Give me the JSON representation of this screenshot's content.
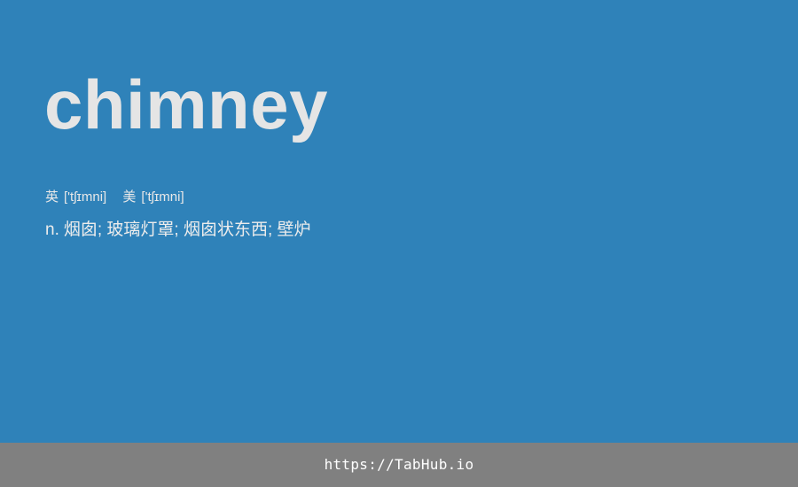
{
  "entry": {
    "word": "chimney",
    "phonetics": [
      {
        "region": "英",
        "ipa": "['tʃɪmni]"
      },
      {
        "region": "美",
        "ipa": "['tʃɪmni]"
      }
    ],
    "definition": {
      "pos": "n.",
      "meanings": "烟囱; 玻璃灯罩; 烟囱状东西; 壁炉"
    }
  },
  "footer": {
    "url": "https://TabHub.io"
  },
  "colors": {
    "background": "#2f82b9",
    "footer_background": "#808080",
    "word_text": "#e5e5e5"
  }
}
